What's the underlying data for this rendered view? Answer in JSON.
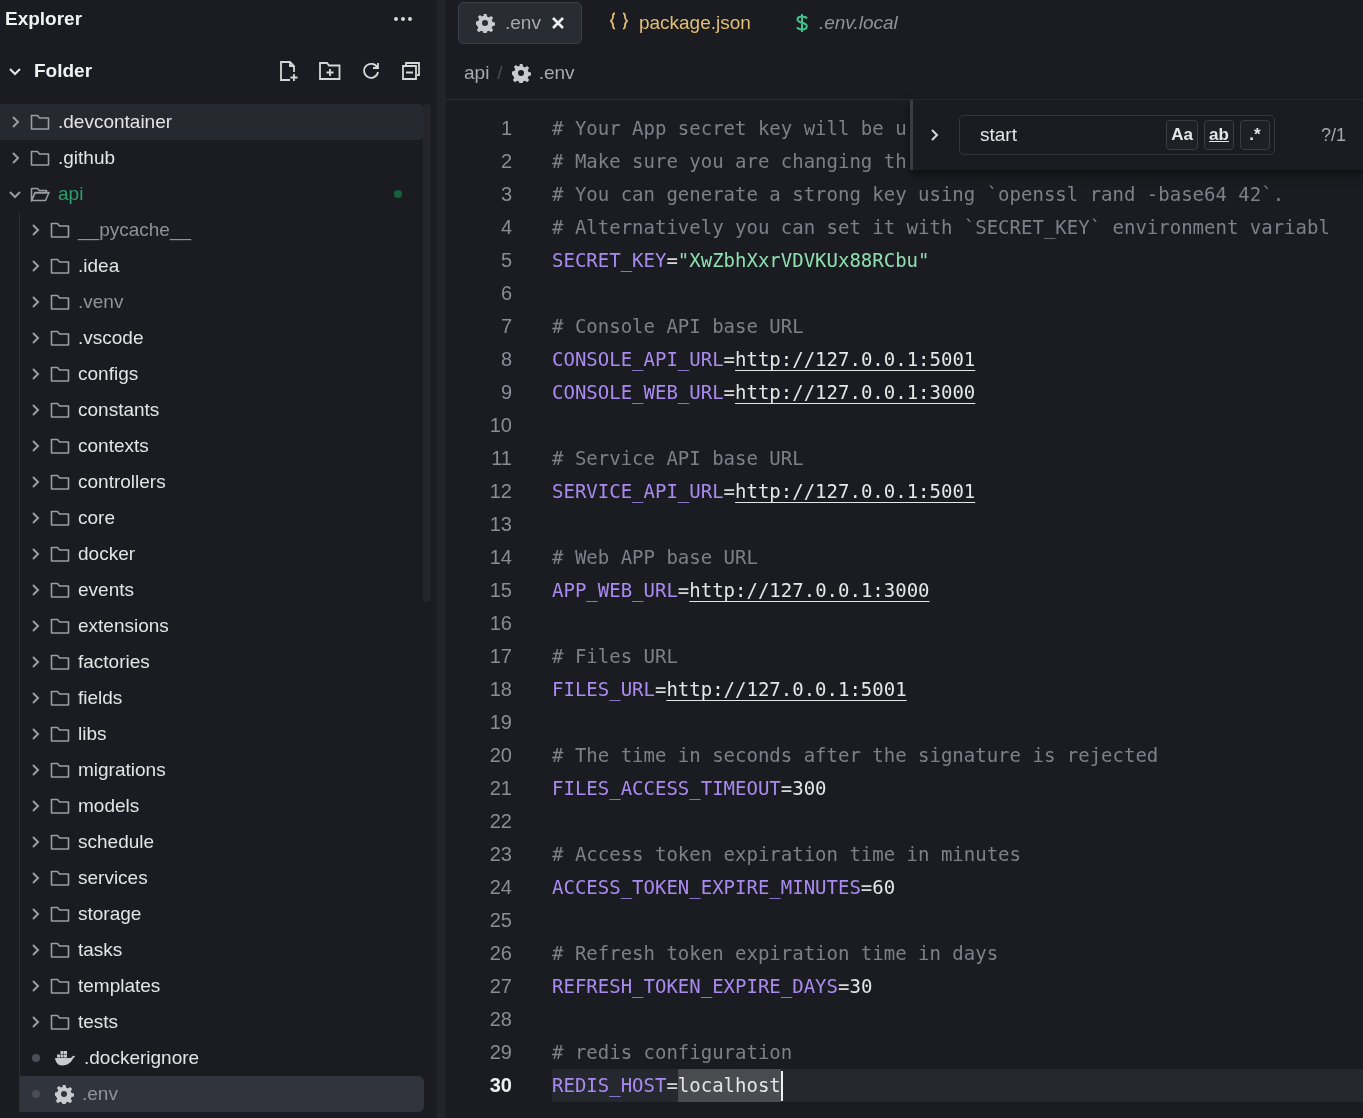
{
  "sidebar": {
    "title": "Explorer",
    "section": {
      "title": "Folder",
      "expanded": true
    },
    "tree": [
      {
        "name": ".devcontainer",
        "kind": "folder",
        "expanded": false,
        "selected": false,
        "hovered": true,
        "ignored": false,
        "modified": false
      },
      {
        "name": ".github",
        "kind": "folder",
        "expanded": false,
        "selected": false,
        "hovered": false,
        "ignored": false,
        "modified": false
      },
      {
        "name": "api",
        "kind": "folder",
        "expanded": true,
        "selected": false,
        "hovered": false,
        "ignored": false,
        "modified": true,
        "children": [
          {
            "name": "__pycache__",
            "kind": "folder",
            "expanded": false,
            "selected": false,
            "hovered": false,
            "ignored": true,
            "modified": false
          },
          {
            "name": ".idea",
            "kind": "folder",
            "expanded": false,
            "selected": false,
            "hovered": false,
            "ignored": false,
            "modified": false
          },
          {
            "name": ".venv",
            "kind": "folder",
            "expanded": false,
            "selected": false,
            "hovered": false,
            "ignored": true,
            "modified": false
          },
          {
            "name": ".vscode",
            "kind": "folder",
            "expanded": false,
            "selected": false,
            "hovered": false,
            "ignored": false,
            "modified": false
          },
          {
            "name": "configs",
            "kind": "folder",
            "expanded": false,
            "selected": false,
            "hovered": false,
            "ignored": false,
            "modified": false
          },
          {
            "name": "constants",
            "kind": "folder",
            "expanded": false,
            "selected": false,
            "hovered": false,
            "ignored": false,
            "modified": false
          },
          {
            "name": "contexts",
            "kind": "folder",
            "expanded": false,
            "selected": false,
            "hovered": false,
            "ignored": false,
            "modified": false
          },
          {
            "name": "controllers",
            "kind": "folder",
            "expanded": false,
            "selected": false,
            "hovered": false,
            "ignored": false,
            "modified": false
          },
          {
            "name": "core",
            "kind": "folder",
            "expanded": false,
            "selected": false,
            "hovered": false,
            "ignored": false,
            "modified": false
          },
          {
            "name": "docker",
            "kind": "folder",
            "expanded": false,
            "selected": false,
            "hovered": false,
            "ignored": false,
            "modified": false
          },
          {
            "name": "events",
            "kind": "folder",
            "expanded": false,
            "selected": false,
            "hovered": false,
            "ignored": false,
            "modified": false
          },
          {
            "name": "extensions",
            "kind": "folder",
            "expanded": false,
            "selected": false,
            "hovered": false,
            "ignored": false,
            "modified": false
          },
          {
            "name": "factories",
            "kind": "folder",
            "expanded": false,
            "selected": false,
            "hovered": false,
            "ignored": false,
            "modified": false
          },
          {
            "name": "fields",
            "kind": "folder",
            "expanded": false,
            "selected": false,
            "hovered": false,
            "ignored": false,
            "modified": false
          },
          {
            "name": "libs",
            "kind": "folder",
            "expanded": false,
            "selected": false,
            "hovered": false,
            "ignored": false,
            "modified": false
          },
          {
            "name": "migrations",
            "kind": "folder",
            "expanded": false,
            "selected": false,
            "hovered": false,
            "ignored": false,
            "modified": false
          },
          {
            "name": "models",
            "kind": "folder",
            "expanded": false,
            "selected": false,
            "hovered": false,
            "ignored": false,
            "modified": false
          },
          {
            "name": "schedule",
            "kind": "folder",
            "expanded": false,
            "selected": false,
            "hovered": false,
            "ignored": false,
            "modified": false
          },
          {
            "name": "services",
            "kind": "folder",
            "expanded": false,
            "selected": false,
            "hovered": false,
            "ignored": false,
            "modified": false
          },
          {
            "name": "storage",
            "kind": "folder",
            "expanded": false,
            "selected": false,
            "hovered": false,
            "ignored": false,
            "modified": false
          },
          {
            "name": "tasks",
            "kind": "folder",
            "expanded": false,
            "selected": false,
            "hovered": false,
            "ignored": false,
            "modified": false
          },
          {
            "name": "templates",
            "kind": "folder",
            "expanded": false,
            "selected": false,
            "hovered": false,
            "ignored": false,
            "modified": false
          },
          {
            "name": "tests",
            "kind": "folder",
            "expanded": false,
            "selected": false,
            "hovered": false,
            "ignored": false,
            "modified": false
          },
          {
            "name": ".dockerignore",
            "kind": "docker",
            "selected": false,
            "hovered": false,
            "ignored": false,
            "modified": false
          },
          {
            "name": ".env",
            "kind": "config",
            "selected": true,
            "hovered": false,
            "ignored": true,
            "modified": false
          }
        ]
      }
    ]
  },
  "tabs": [
    {
      "label": ".env",
      "kind": "config",
      "selected": true,
      "modified": false,
      "preview": false
    },
    {
      "label": "package.json",
      "kind": "json",
      "selected": false,
      "modified": true,
      "preview": false
    },
    {
      "label": ".env.local",
      "kind": "shell",
      "selected": false,
      "modified": false,
      "preview": true
    }
  ],
  "breadcrumb": {
    "separator": "/",
    "items": [
      {
        "label": "api",
        "kind": "folder"
      },
      {
        "label": ".env",
        "kind": "config"
      }
    ]
  },
  "find": {
    "value": "start",
    "options": [
      {
        "label": "Aa",
        "on": false
      },
      {
        "label": "ab",
        "on": false
      },
      {
        "label": ".*",
        "on": false
      }
    ],
    "count": "?/1"
  },
  "lines": [
    {
      "number": "1",
      "tokens": [
        {
          "kind": "comment",
          "text": "# Your App secret key will be u"
        }
      ]
    },
    {
      "number": "2",
      "tokens": [
        {
          "kind": "comment",
          "text": "# Make sure you are changing th"
        }
      ]
    },
    {
      "number": "3",
      "tokens": [
        {
          "kind": "comment",
          "text": "# You can generate a strong key using `openssl rand -base64 42`."
        }
      ]
    },
    {
      "number": "4",
      "tokens": [
        {
          "kind": "comment",
          "text": "# Alternatively you can set it with `SECRET_KEY` environment variabl"
        }
      ]
    },
    {
      "number": "5",
      "tokens": [
        {
          "kind": "key",
          "text": "SECRET_KEY"
        },
        {
          "kind": "op",
          "text": "="
        },
        {
          "kind": "string",
          "text": "\"XwZbhXxrVDVKUx88RCbu\""
        }
      ]
    },
    {
      "number": "6"
    },
    {
      "number": "7",
      "tokens": [
        {
          "kind": "comment",
          "text": "# Console API base URL"
        }
      ]
    },
    {
      "number": "8",
      "tokens": [
        {
          "kind": "key",
          "text": "CONSOLE_API_URL"
        },
        {
          "kind": "op",
          "text": "="
        },
        {
          "kind": "url",
          "text": "http://127.0.0.1:5001"
        }
      ]
    },
    {
      "number": "9",
      "tokens": [
        {
          "kind": "key",
          "text": "CONSOLE_WEB_URL"
        },
        {
          "kind": "op",
          "text": "="
        },
        {
          "kind": "url",
          "text": "http://127.0.0.1:3000"
        }
      ]
    },
    {
      "number": "10"
    },
    {
      "number": "11",
      "tokens": [
        {
          "kind": "comment",
          "text": "# Service API base URL"
        }
      ]
    },
    {
      "number": "12",
      "tokens": [
        {
          "kind": "key",
          "text": "SERVICE_API_URL"
        },
        {
          "kind": "op",
          "text": "="
        },
        {
          "kind": "url",
          "text": "http://127.0.0.1:5001"
        }
      ]
    },
    {
      "number": "13"
    },
    {
      "number": "14",
      "tokens": [
        {
          "kind": "comment",
          "text": "# Web APP base URL"
        }
      ]
    },
    {
      "number": "15",
      "tokens": [
        {
          "kind": "key",
          "text": "APP_WEB_URL"
        },
        {
          "kind": "op",
          "text": "="
        },
        {
          "kind": "url",
          "text": "http://127.0.0.1:3000"
        }
      ]
    },
    {
      "number": "16"
    },
    {
      "number": "17",
      "tokens": [
        {
          "kind": "comment",
          "text": "# Files URL"
        }
      ]
    },
    {
      "number": "18",
      "tokens": [
        {
          "kind": "key",
          "text": "FILES_URL"
        },
        {
          "kind": "op",
          "text": "="
        },
        {
          "kind": "url",
          "text": "http://127.0.0.1:5001"
        }
      ]
    },
    {
      "number": "19"
    },
    {
      "number": "20",
      "tokens": [
        {
          "kind": "comment",
          "text": "# The time in seconds after the signature is rejected"
        }
      ]
    },
    {
      "number": "21",
      "tokens": [
        {
          "kind": "key",
          "text": "FILES_ACCESS_TIMEOUT"
        },
        {
          "kind": "op",
          "text": "="
        },
        {
          "kind": "number",
          "text": "300"
        }
      ]
    },
    {
      "number": "22"
    },
    {
      "number": "23",
      "tokens": [
        {
          "kind": "comment",
          "text": "# Access token expiration time in minutes"
        }
      ]
    },
    {
      "number": "24",
      "tokens": [
        {
          "kind": "key",
          "text": "ACCESS_TOKEN_EXPIRE_MINUTES"
        },
        {
          "kind": "op",
          "text": "="
        },
        {
          "kind": "number",
          "text": "60"
        }
      ]
    },
    {
      "number": "25"
    },
    {
      "number": "26",
      "tokens": [
        {
          "kind": "comment",
          "text": "# Refresh token expiration time in days"
        }
      ]
    },
    {
      "number": "27",
      "tokens": [
        {
          "kind": "key",
          "text": "REFRESH_TOKEN_EXPIRE_DAYS"
        },
        {
          "kind": "op",
          "text": "="
        },
        {
          "kind": "number",
          "text": "30"
        }
      ]
    },
    {
      "number": "28"
    },
    {
      "number": "29",
      "tokens": [
        {
          "kind": "comment",
          "text": "# redis configuration"
        }
      ]
    },
    {
      "number": "30",
      "current": true,
      "tokens": [
        {
          "kind": "key",
          "text": "REDIS_HOST"
        },
        {
          "kind": "op",
          "text": "="
        },
        {
          "kind": "plain",
          "text": "localhost",
          "selected": true
        }
      ]
    }
  ]
}
